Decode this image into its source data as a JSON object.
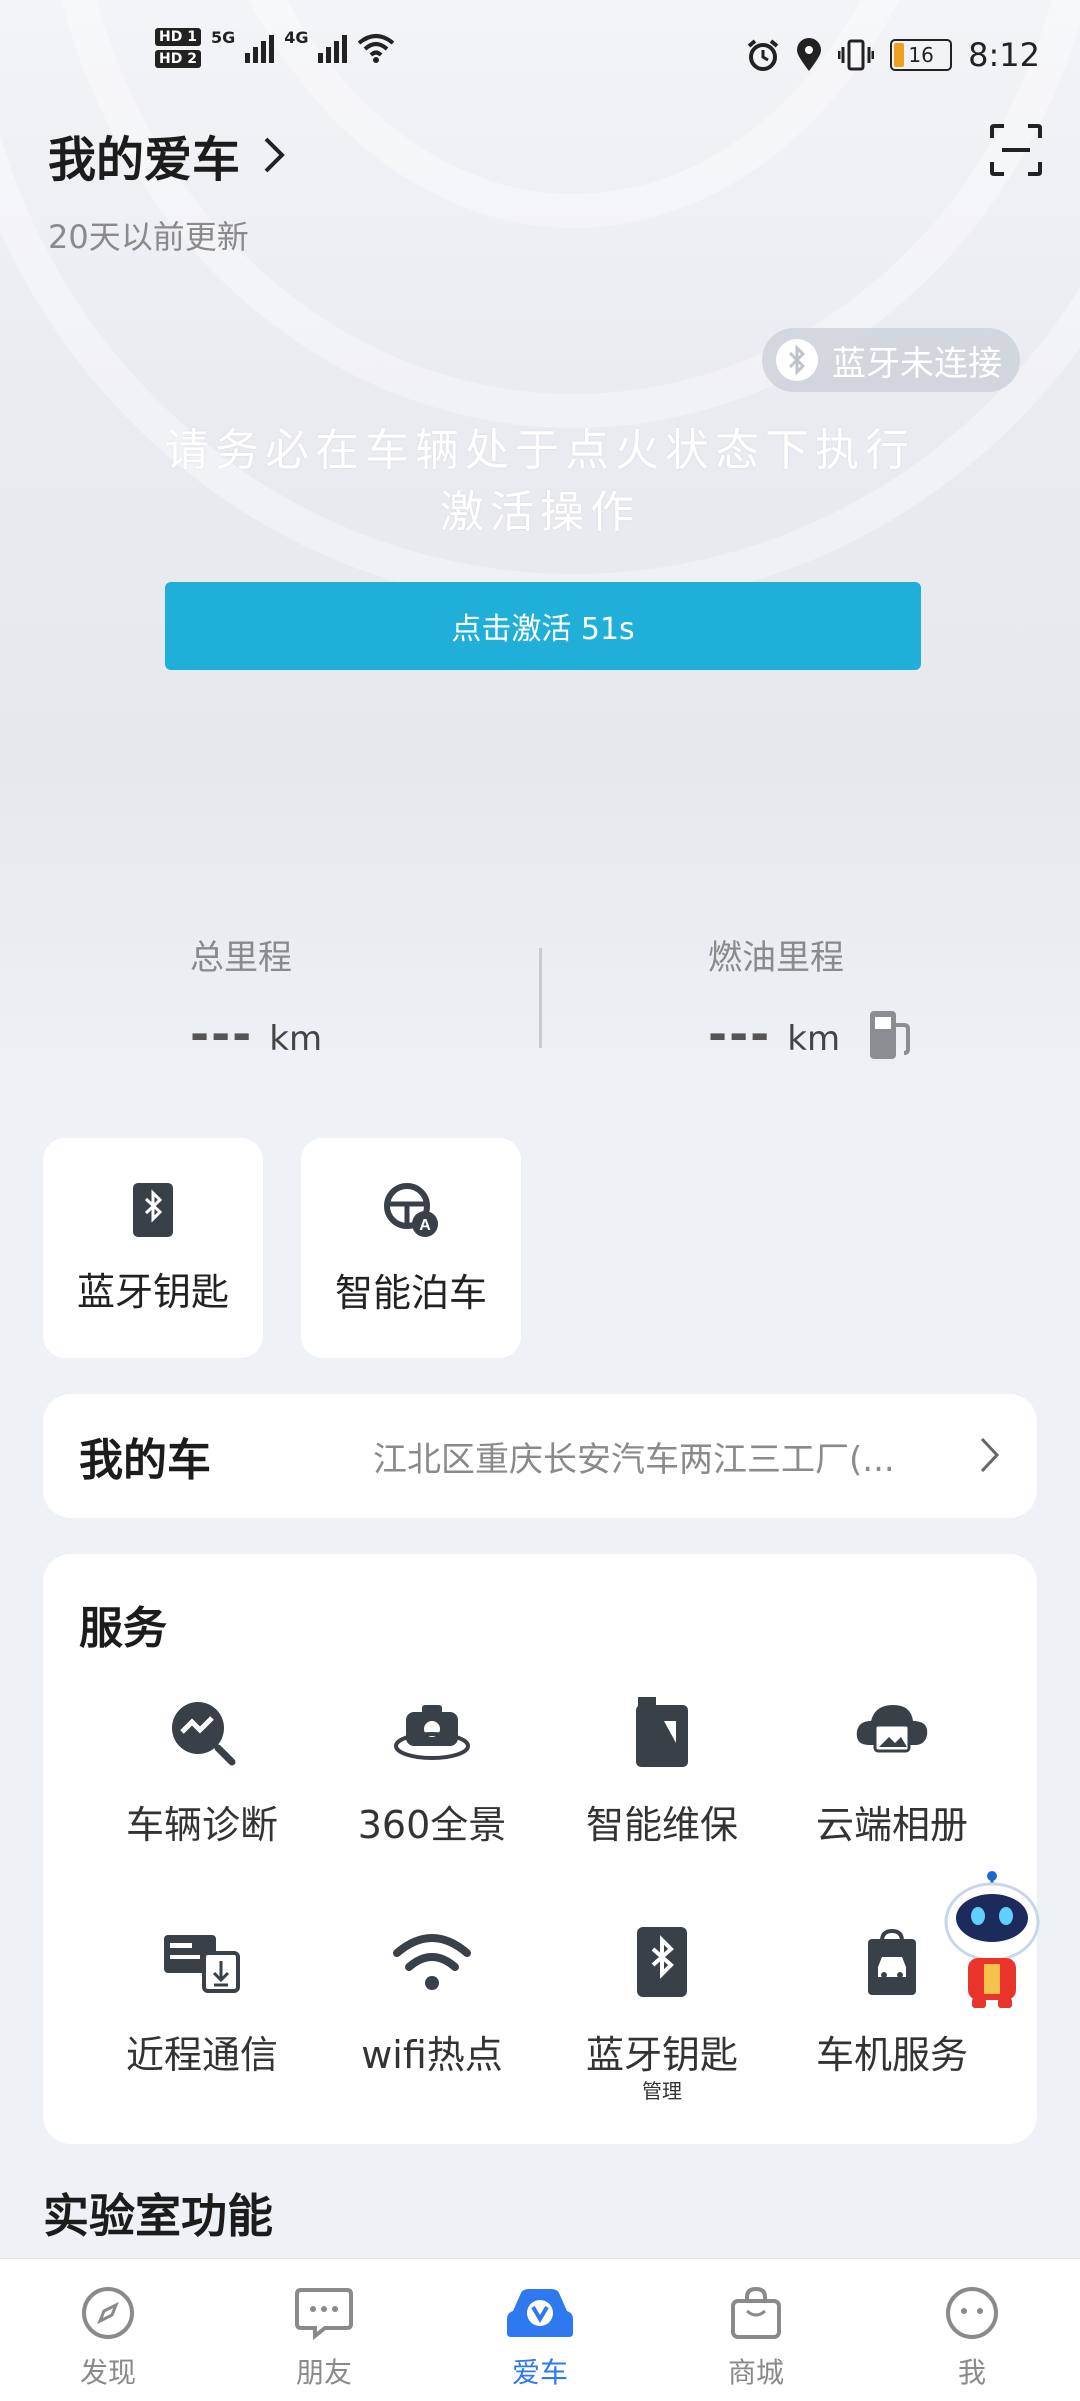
{
  "status_bar": {
    "sim1": "HD 1",
    "sim2": "HD 2",
    "net1": "5G",
    "net2": "4G",
    "battery": "16",
    "time": "8:12"
  },
  "header": {
    "title": "我的爱车",
    "updated": "20天以前更新"
  },
  "bluetooth_status": "蓝牙未连接",
  "notice": "请务必在车辆处于点火状态下执行激活操作",
  "activate_button": "点击激活 51s",
  "stats": {
    "total_mileage": {
      "label": "总里程",
      "value": "---",
      "unit": "km"
    },
    "fuel_mileage": {
      "label": "燃油里程",
      "value": "---",
      "unit": "km"
    }
  },
  "quick_tiles": [
    {
      "label": "蓝牙钥匙",
      "icon": "bluetooth-key-icon"
    },
    {
      "label": "智能泊车",
      "icon": "auto-parking-icon"
    }
  ],
  "my_car": {
    "label": "我的车",
    "location": "江北区重庆长安汽车两江三工厂(..."
  },
  "services": {
    "heading": "服务",
    "items": [
      {
        "label": "车辆诊断",
        "icon": "diagnosis-icon"
      },
      {
        "label": "360全景",
        "icon": "camera-360-icon"
      },
      {
        "label": "智能维保",
        "icon": "maintenance-icon"
      },
      {
        "label": "云端相册",
        "icon": "cloud-album-icon"
      },
      {
        "label": "近程通信",
        "icon": "near-comm-icon"
      },
      {
        "label": "wifi热点",
        "icon": "wifi-icon"
      },
      {
        "label": "蓝牙钥匙",
        "sub": "管理",
        "icon": "bluetooth-key-icon"
      },
      {
        "label": "车机服务",
        "icon": "car-service-icon"
      }
    ]
  },
  "lab_heading": "实验室功能",
  "tabs": [
    {
      "label": "发现",
      "icon": "compass-icon"
    },
    {
      "label": "朋友",
      "icon": "chat-icon"
    },
    {
      "label": "爱车",
      "icon": "car-logo-icon",
      "active": true
    },
    {
      "label": "商城",
      "icon": "bag-icon"
    },
    {
      "label": "我",
      "icon": "face-icon"
    }
  ],
  "colors": {
    "accent": "#1fafd8",
    "tab_active": "#2e78f0",
    "icon_dark": "#3a4048"
  }
}
